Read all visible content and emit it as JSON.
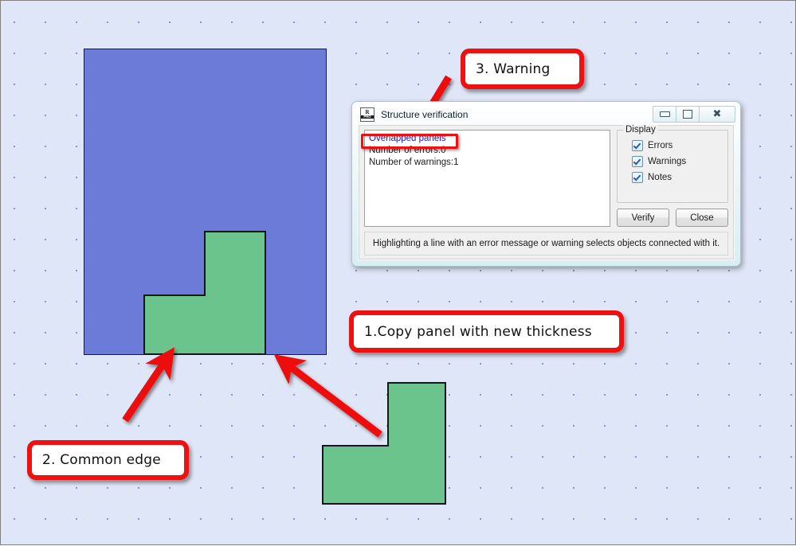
{
  "canvas": {
    "background_color": "#dfe6f7",
    "grid_dot_color": "#8a93cc"
  },
  "shapes": {
    "blue_panel": {
      "name": "blue-panel",
      "color": "#6c7ad8"
    },
    "green_overlap_panel": {
      "name": "green-overlapping-panel",
      "color": "#6cc48d"
    },
    "green_copied_panel": {
      "name": "green-copied-panel",
      "color": "#6cc48d"
    }
  },
  "callouts": {
    "warning": "3. Warning",
    "copy": "1.Copy panel with new thickness",
    "edge": "2. Common edge",
    "border_color": "#ee1111"
  },
  "dialog": {
    "title": "Structure verification",
    "icon_top": "R",
    "icon_bottom": "PRO",
    "window_controls": {
      "minimize": "minimize-button",
      "maximize": "maximize-button",
      "close": "close-button"
    },
    "messages": [
      {
        "text": "Overlapped panels",
        "style": "link"
      },
      {
        "text": "Number of errors:0",
        "style": "plain"
      },
      {
        "text": "Number of warnings:1",
        "style": "plain"
      }
    ],
    "display_group": {
      "legend": "Display",
      "options": [
        {
          "label": "Errors",
          "checked": true
        },
        {
          "label": "Warnings",
          "checked": true
        },
        {
          "label": "Notes",
          "checked": true
        }
      ]
    },
    "buttons": {
      "verify": "Verify",
      "close": "Close"
    },
    "status_text": "Highlighting a line with an error message or warning selects objects connected with it."
  }
}
